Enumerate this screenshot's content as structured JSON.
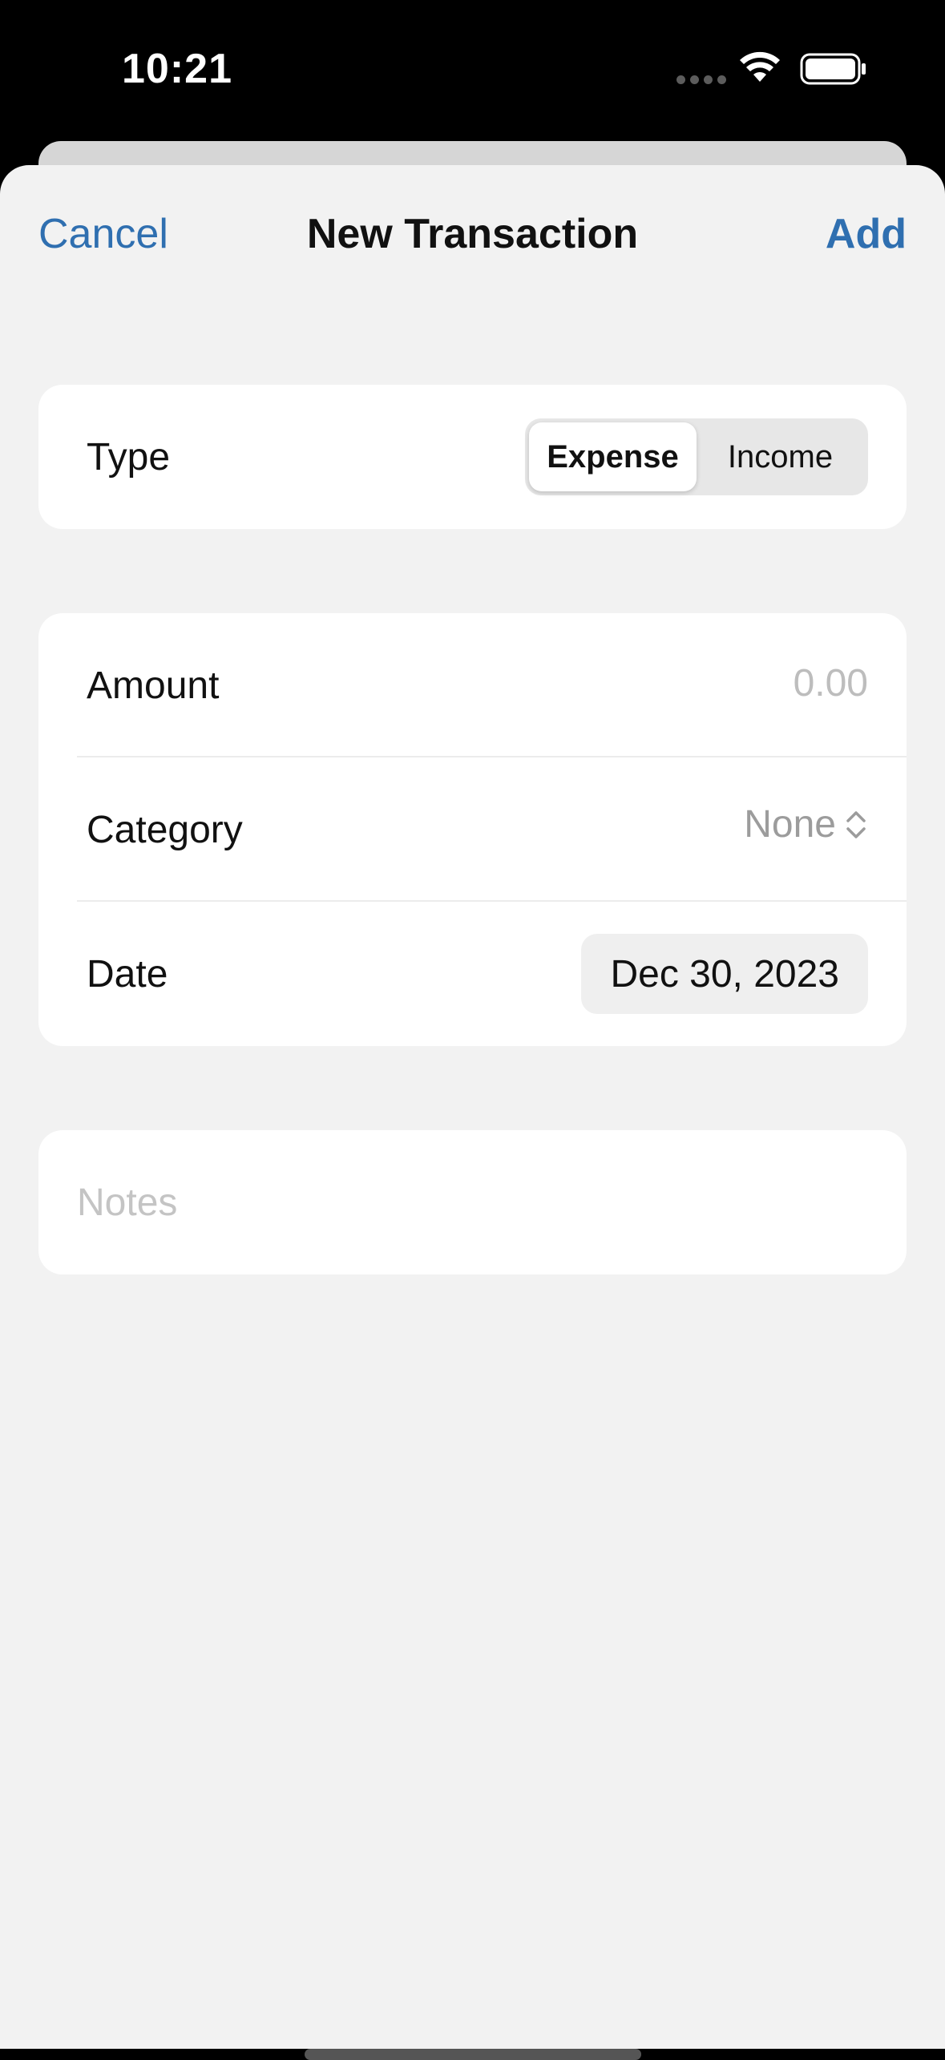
{
  "status_bar": {
    "time": "10:21"
  },
  "nav": {
    "cancel_label": "Cancel",
    "title": "New Transaction",
    "add_label": "Add"
  },
  "type_row": {
    "label": "Type",
    "options": [
      "Expense",
      "Income"
    ],
    "selected": "Expense"
  },
  "details": {
    "amount": {
      "label": "Amount",
      "value": "",
      "placeholder": "0.00"
    },
    "category": {
      "label": "Category",
      "value": "None"
    },
    "date": {
      "label": "Date",
      "value": "Dec 30, 2023"
    }
  },
  "notes": {
    "value": "",
    "placeholder": "Notes"
  },
  "colors": {
    "accent": "#2f6fb0",
    "background": "#f2f2f2",
    "card": "#ffffff"
  },
  "icons": [
    "wifi-icon",
    "battery-icon",
    "chevron-up-down-icon"
  ]
}
